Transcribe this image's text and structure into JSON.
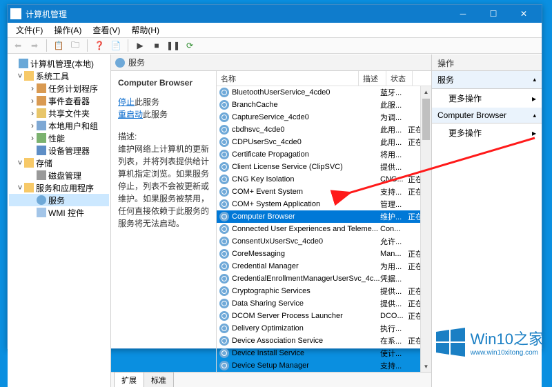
{
  "window": {
    "title": "计算机管理"
  },
  "menu": [
    "文件(F)",
    "操作(A)",
    "查看(V)",
    "帮助(H)"
  ],
  "tree": {
    "root": "计算机管理(本地)",
    "g1": "系统工具",
    "g1_items": [
      "任务计划程序",
      "事件查看器",
      "共享文件夹",
      "本地用户和组",
      "性能",
      "设备管理器"
    ],
    "g2": "存储",
    "g2_items": [
      "磁盘管理"
    ],
    "g3": "服务和应用程序",
    "g3_items": [
      "服务",
      "WMI 控件"
    ]
  },
  "services_header": "服务",
  "detail": {
    "title": "Computer Browser",
    "stop_link": "停止",
    "stop_suffix": "此服务",
    "restart_link": "重启动",
    "restart_suffix": "此服务",
    "desc_label": "描述:",
    "desc": "维护网络上计算机的更新列表，并将列表提供给计算机指定浏览。如果服务停止，列表不会被更新或维护。如果服务被禁用，任何直接依赖于此服务的服务将无法启动。"
  },
  "columns": {
    "name": "名称",
    "desc": "描述",
    "status": "状态"
  },
  "rows": [
    {
      "n": "BluetoothUserService_4cde0",
      "d": "蓝牙...",
      "s": ""
    },
    {
      "n": "BranchCache",
      "d": "此服...",
      "s": ""
    },
    {
      "n": "CaptureService_4cde0",
      "d": "为调...",
      "s": ""
    },
    {
      "n": "cbdhsvc_4cde0",
      "d": "此用...",
      "s": "正在..."
    },
    {
      "n": "CDPUserSvc_4cde0",
      "d": "此用...",
      "s": "正在..."
    },
    {
      "n": "Certificate Propagation",
      "d": "将用...",
      "s": ""
    },
    {
      "n": "Client License Service (ClipSVC)",
      "d": "提供...",
      "s": ""
    },
    {
      "n": "CNG Key Isolation",
      "d": "CNG...",
      "s": "正在..."
    },
    {
      "n": "COM+ Event System",
      "d": "支持...",
      "s": "正在..."
    },
    {
      "n": "COM+ System Application",
      "d": "管理...",
      "s": ""
    },
    {
      "n": "Computer Browser",
      "d": "维护...",
      "s": "正在...",
      "sel": true
    },
    {
      "n": "Connected User Experiences and Teleme...",
      "d": "Con...",
      "s": ""
    },
    {
      "n": "ConsentUxUserSvc_4cde0",
      "d": "允许...",
      "s": ""
    },
    {
      "n": "CoreMessaging",
      "d": "Man...",
      "s": "正在..."
    },
    {
      "n": "Credential Manager",
      "d": "为用...",
      "s": "正在..."
    },
    {
      "n": "CredentialEnrollmentManagerUserSvc_4c...",
      "d": "凭据...",
      "s": ""
    },
    {
      "n": "Cryptographic Services",
      "d": "提供...",
      "s": "正在..."
    },
    {
      "n": "Data Sharing Service",
      "d": "提供...",
      "s": "正在..."
    },
    {
      "n": "DCOM Server Process Launcher",
      "d": "DCO...",
      "s": "正在..."
    },
    {
      "n": "Delivery Optimization",
      "d": "执行...",
      "s": ""
    },
    {
      "n": "Device Association Service",
      "d": "在系...",
      "s": "正在..."
    },
    {
      "n": "Device Install Service",
      "d": "使计...",
      "s": ""
    },
    {
      "n": "Device Setup Manager",
      "d": "支持...",
      "s": ""
    }
  ],
  "tabs": [
    "扩展",
    "标准"
  ],
  "actions": {
    "header": "操作",
    "sec1": "服务",
    "item1": "更多操作",
    "sec2": "Computer Browser",
    "item2": "更多操作"
  },
  "watermark": {
    "brand": "Win10之家",
    "url": "www.win10xitong.com"
  }
}
